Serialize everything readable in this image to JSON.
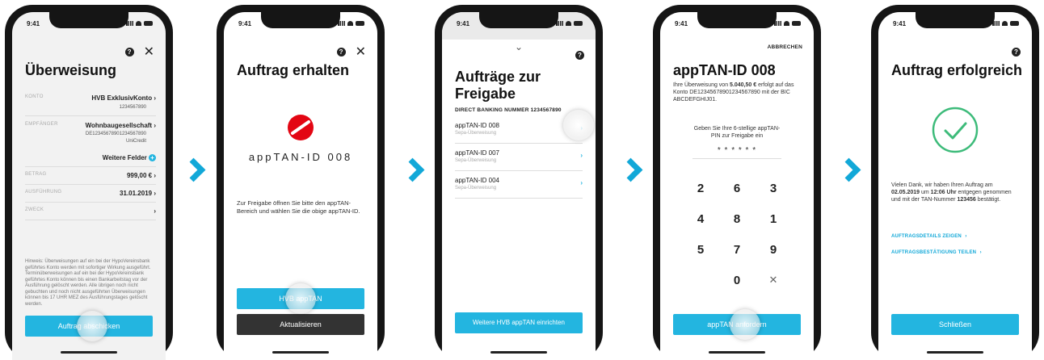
{
  "status": {
    "time": "9:41"
  },
  "icons": {
    "help": "?",
    "close": "✕",
    "chevron": "›",
    "clear": "✕",
    "plus": "+",
    "down": "⌄"
  },
  "step1": {
    "title": "Überweisung",
    "konto_label": "KONTO",
    "konto_value": "HVB ExklusivKonto",
    "konto_number": "1234567890",
    "empf_label": "EMPFÄNGER",
    "empf_value": "Wohnbaugesellschaft",
    "empf_iban": "DE12345678901234567890",
    "empf_bank": "UniCredit",
    "more_fields": "Weitere Felder",
    "betrag_label": "BETRAG",
    "betrag_value": "999,00 €",
    "ausf_label": "AUSFÜHRUNG",
    "ausf_value": "31.01.2019",
    "zweck_label": "ZWECK",
    "hint": "Hinweis: Überweisungen auf ein bei der HypoVereinsbank geführtes Konto werden mit sofortiger Wirkung ausgeführt. Terminüberweisungen auf ein bei der HypoVereinsbank geführtes Konto können bis einen Bankarbeitstag vor der Ausführung gelöscht werden. Alle übrigen noch nicht gebuchten und noch nicht ausgeführten Überweisungen können bis 17 UHR MEZ des Ausführungstages gelöscht werden.",
    "submit": "Auftrag abschicken"
  },
  "step2": {
    "title": "Auftrag erhalten",
    "app_id": "appTAN-ID 008",
    "info": "Zur Freigabe öffnen Sie bitte den appTAN-Bereich und wählen Sie die obige appTAN-ID.",
    "primary": "HVB appTAN",
    "secondary": "Aktualisieren"
  },
  "step3": {
    "title": "Aufträge zur Freigabe",
    "section": "DIRECT BANKING NUMMER 1234567890",
    "items": [
      {
        "id": "appTAN-ID 008",
        "type": "Sepa-Überweisung"
      },
      {
        "id": "appTAN-ID 007",
        "type": "Sepa-Überweisung"
      },
      {
        "id": "appTAN-ID 004",
        "type": "Sepa-Überweisung"
      }
    ],
    "button": "Weitere HVB appTAN einrichten"
  },
  "step4": {
    "cancel": "ABBRECHEN",
    "title": "appTAN-ID 008",
    "text_pre": "Ihre Überweisung von ",
    "amount": "5.040,50 €",
    "text_post": " erfolgt auf das Konto DE12345678901234567890 mit der BIC ABCDEFGHIJ01.",
    "pin_prompt": "Geben Sie Ihre 6-stellige appTAN-PIN zur Freigabe ein",
    "pin_mask": "* * * * * *",
    "keys": [
      "2",
      "6",
      "3",
      "4",
      "8",
      "1",
      "5",
      "7",
      "9",
      "0"
    ],
    "button": "appTAN anfordern"
  },
  "step5": {
    "title": "Auftrag erfolgreich",
    "msg_1": "Vielen Dank, wir haben Ihren Auftrag am ",
    "date": "02.05.2019",
    "msg_2": " um ",
    "time": "12:06 Uhr",
    "msg_3": " entgegen genommen und mit der TAN-Nummer ",
    "tan": "123456",
    "msg_4": " bestätigt.",
    "link1": "AUFTRAGSDETAILS ZEIGEN",
    "link2": "AUFTRAGSBESTÄTIGUNG TEILEN",
    "button": "Schließen"
  },
  "colors": {
    "accent": "#23b5e0",
    "chevron": "#12a8d8",
    "success": "#3dbb7a",
    "brand_red": "#e30613"
  }
}
